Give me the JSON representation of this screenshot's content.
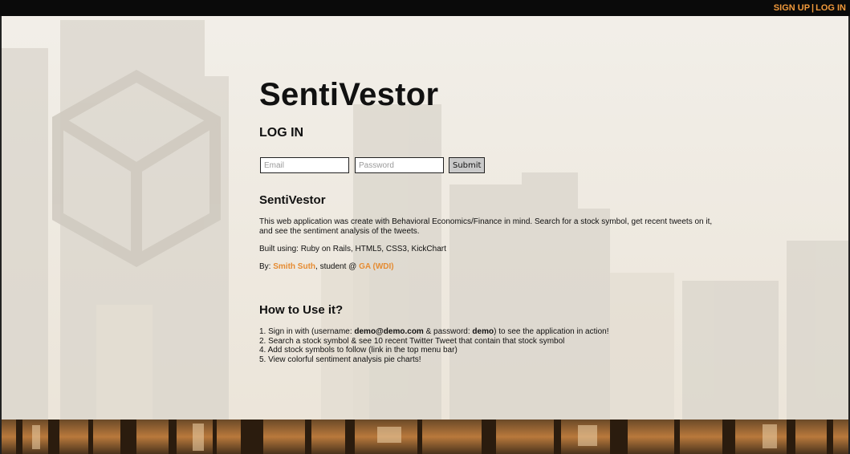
{
  "topnav": {
    "signup": "SIGN UP",
    "separator": "|",
    "login": "LOG IN"
  },
  "main": {
    "title": "SentiVestor",
    "login_heading": "LOG IN",
    "email_placeholder": "Email",
    "password_placeholder": "Password",
    "submit_label": "Submit",
    "about_heading": "SentiVestor",
    "about_text": "This web application was create with Behavioral Economics/Finance in mind. Search for a stock symbol, get recent tweets on it, and see the sentiment analysis of the tweets.",
    "built_using": "Built using: Ruby on Rails, HTML5, CSS3, KickChart",
    "by_prefix": "By: ",
    "author": "Smith Suth",
    "by_middle": ", student @ ",
    "school": "GA (WDI)",
    "howto_heading": "How to Use it?",
    "steps": {
      "s1_a": "1. Sign in with (username: ",
      "s1_user": "demo@demo.com",
      "s1_b": " & password: ",
      "s1_pass": "demo",
      "s1_c": ") to see the application in action!",
      "s2": "2. Search a stock symbol & see 10 recent Twitter Tweet that contain that stock symbol",
      "s4": "4. Add stock symbols to follow (link in the top menu bar)",
      "s5": "5. View colorful sentiment analysis pie charts!"
    }
  },
  "colors": {
    "accent": "#f29a3b",
    "link": "#e58b32",
    "topbar": "#0a0a0a"
  },
  "icons": {
    "background_logo": "cube-logo-icon"
  }
}
